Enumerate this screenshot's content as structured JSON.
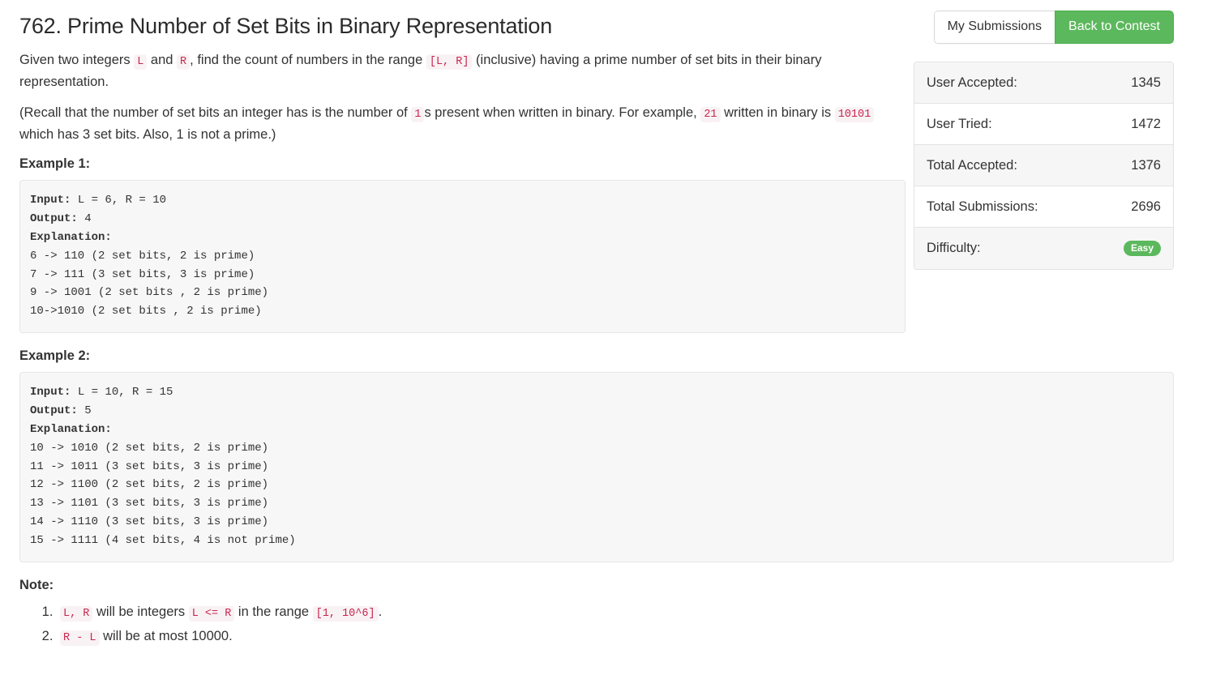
{
  "header": {
    "title": "762. Prime Number of Set Bits in Binary Representation",
    "my_submissions_label": "My Submissions",
    "back_to_contest_label": "Back to Contest"
  },
  "colors": {
    "primary_green": "#5cb85c",
    "inline_code_text": "#c7254e",
    "inline_code_bg": "#f9f2f4",
    "code_block_bg": "#f7f7f7"
  },
  "description": {
    "para1": {
      "t1": "Given two integers ",
      "c1": "L",
      "t2": " and ",
      "c2": "R",
      "t3": ", find the count of numbers in the range ",
      "c3": "[L, R]",
      "t4": " (inclusive) having a prime number of set bits in their binary representation."
    },
    "para2": {
      "t1": "(Recall that the number of set bits an integer has is the number of ",
      "c1": "1",
      "t2": "s present when written in binary. For example, ",
      "c2": "21",
      "t3": " written in binary is ",
      "c3": "10101",
      "t4": " which has 3 set bits. Also, 1 is not a prime.)"
    }
  },
  "examples": [
    {
      "heading": "Example 1:",
      "input_label": "Input:",
      "input_value": " L = 6, R = 10",
      "output_label": "Output:",
      "output_value": " 4",
      "explanation_label": "Explanation:",
      "explanation_lines": [
        "6 -> 110 (2 set bits, 2 is prime)",
        "7 -> 111 (3 set bits, 3 is prime)",
        "9 -> 1001 (2 set bits , 2 is prime)",
        "10->1010 (2 set bits , 2 is prime)"
      ]
    },
    {
      "heading": "Example 2:",
      "input_label": "Input:",
      "input_value": " L = 10, R = 15",
      "output_label": "Output:",
      "output_value": " 5",
      "explanation_label": "Explanation:",
      "explanation_lines": [
        "10 -> 1010 (2 set bits, 2 is prime)",
        "11 -> 1011 (3 set bits, 3 is prime)",
        "12 -> 1100 (2 set bits, 2 is prime)",
        "13 -> 1101 (3 set bits, 3 is prime)",
        "14 -> 1110 (3 set bits, 3 is prime)",
        "15 -> 1111 (4 set bits, 4 is not prime)"
      ]
    }
  ],
  "note": {
    "heading": "Note:",
    "items": [
      {
        "c1": "L, R",
        "t1": " will be integers ",
        "c2": "L <= R",
        "t2": " in the range ",
        "c3": "[1, 10^6]",
        "t3": "."
      },
      {
        "c1": "R - L",
        "t1": " will be at most 10000."
      }
    ]
  },
  "stats": {
    "rows": [
      {
        "label": "User Accepted:",
        "value": "1345"
      },
      {
        "label": "User Tried:",
        "value": "1472"
      },
      {
        "label": "Total Accepted:",
        "value": "1376"
      },
      {
        "label": "Total Submissions:",
        "value": "2696"
      }
    ],
    "difficulty_label": "Difficulty:",
    "difficulty_value": "Easy"
  }
}
